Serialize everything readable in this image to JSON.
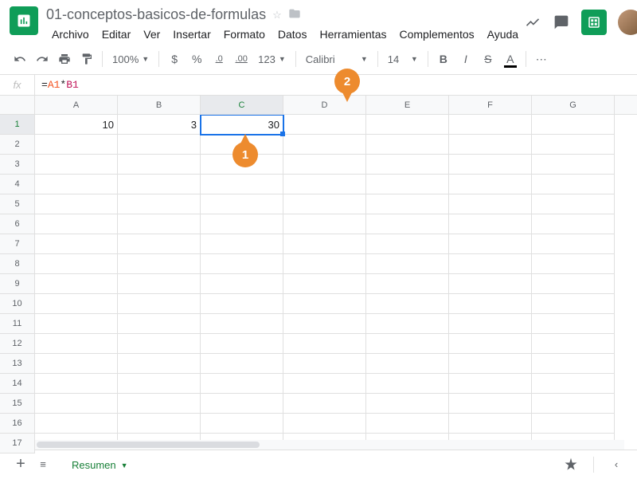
{
  "doc": {
    "title": "01-conceptos-basicos-de-formulas"
  },
  "menu": [
    "Archivo",
    "Editar",
    "Ver",
    "Insertar",
    "Formato",
    "Datos",
    "Herramientas",
    "Complementos",
    "Ayuda"
  ],
  "toolbar": {
    "zoom": "100%",
    "font": "Calibri",
    "size": "14",
    "currency": "$",
    "percent": "%",
    "dec_dec": ".0",
    "inc_dec": ".00",
    "num_fmt": "123"
  },
  "formula": {
    "fx": "fx",
    "eq": "=",
    "ref1": "A1",
    "op": "*",
    "ref2": "B1"
  },
  "columns": [
    "A",
    "B",
    "C",
    "D",
    "E",
    "F",
    "G"
  ],
  "rows": [
    "1",
    "2",
    "3",
    "4",
    "5",
    "6",
    "7",
    "8",
    "9",
    "10",
    "11",
    "12",
    "13",
    "14",
    "15",
    "16",
    "17"
  ],
  "cells": {
    "A1": "10",
    "B1": "3",
    "C1": "30"
  },
  "selected": {
    "col": 2,
    "row": 0
  },
  "sheet": {
    "name": "Resumen"
  },
  "callouts": {
    "c1": "1",
    "c2": "2"
  }
}
